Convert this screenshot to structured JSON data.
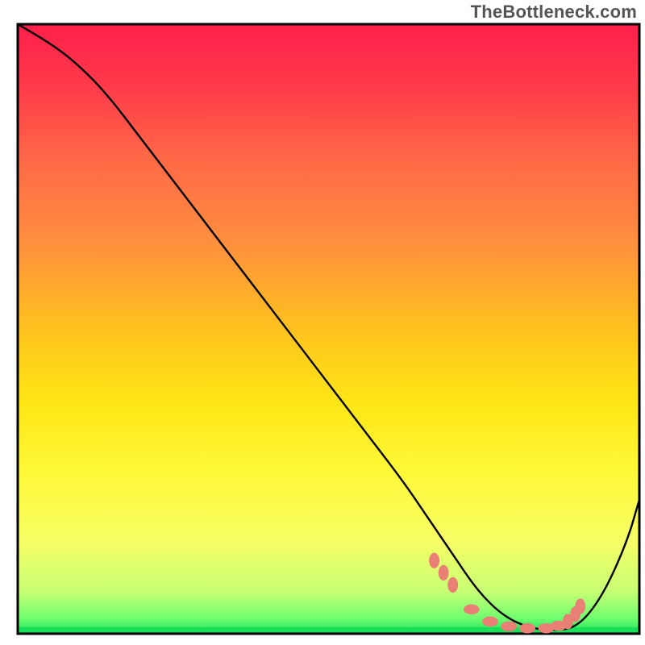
{
  "watermark": "TheBottleneck.com",
  "colors": {
    "frame": "#000000",
    "curve": "#000000",
    "marker_fill": "#e97f75",
    "marker_stroke": "#e97f75",
    "green_band": "#18e058"
  },
  "gradient_stops": [
    {
      "offset": 0.0,
      "color": "#ff1f4b"
    },
    {
      "offset": 0.1,
      "color": "#ff3a4a"
    },
    {
      "offset": 0.22,
      "color": "#ff6847"
    },
    {
      "offset": 0.35,
      "color": "#ff8c3f"
    },
    {
      "offset": 0.5,
      "color": "#ffc21e"
    },
    {
      "offset": 0.62,
      "color": "#ffe615"
    },
    {
      "offset": 0.74,
      "color": "#fff93a"
    },
    {
      "offset": 0.85,
      "color": "#f6ff66"
    },
    {
      "offset": 0.93,
      "color": "#c8ff74"
    },
    {
      "offset": 0.975,
      "color": "#6fff6f"
    },
    {
      "offset": 1.0,
      "color": "#18e058"
    }
  ],
  "chart_data": {
    "type": "line",
    "title": "",
    "xlabel": "",
    "ylabel": "",
    "xlim": [
      0,
      100
    ],
    "ylim": [
      0,
      100
    ],
    "grid": false,
    "legend": false,
    "note": "Axes have no visible tick labels; x/y values are normalized 0–100 estimated from pixel positions within the plot frame.",
    "series": [
      {
        "name": "curve",
        "x": [
          0,
          5,
          9,
          14,
          20,
          26,
          32,
          38,
          44,
          50,
          56,
          62,
          66,
          70,
          74,
          78,
          82,
          86,
          90,
          94,
          98,
          100
        ],
        "y": [
          100,
          97,
          94,
          89,
          81,
          73,
          65,
          57,
          49,
          41,
          33,
          25,
          19,
          13,
          7,
          3,
          1,
          0.5,
          1,
          6,
          15,
          22
        ]
      }
    ],
    "markers": {
      "name": "highlight-points",
      "x": [
        67,
        68.5,
        70,
        73,
        76,
        79,
        82,
        85,
        87,
        88.5,
        89.7,
        90.5
      ],
      "y": [
        12,
        10,
        8,
        4,
        2,
        1.2,
        0.9,
        0.9,
        1.3,
        2,
        3.2,
        4.5
      ],
      "rx": [
        1.4,
        1.4,
        1.4,
        2.2,
        2.2,
        2.2,
        2.2,
        2.2,
        2.2,
        1.4,
        1.4,
        1.4
      ],
      "ry": [
        2.2,
        2.2,
        2.2,
        1.4,
        1.4,
        1.4,
        1.4,
        1.4,
        1.4,
        2.2,
        2.2,
        2.2
      ]
    }
  }
}
